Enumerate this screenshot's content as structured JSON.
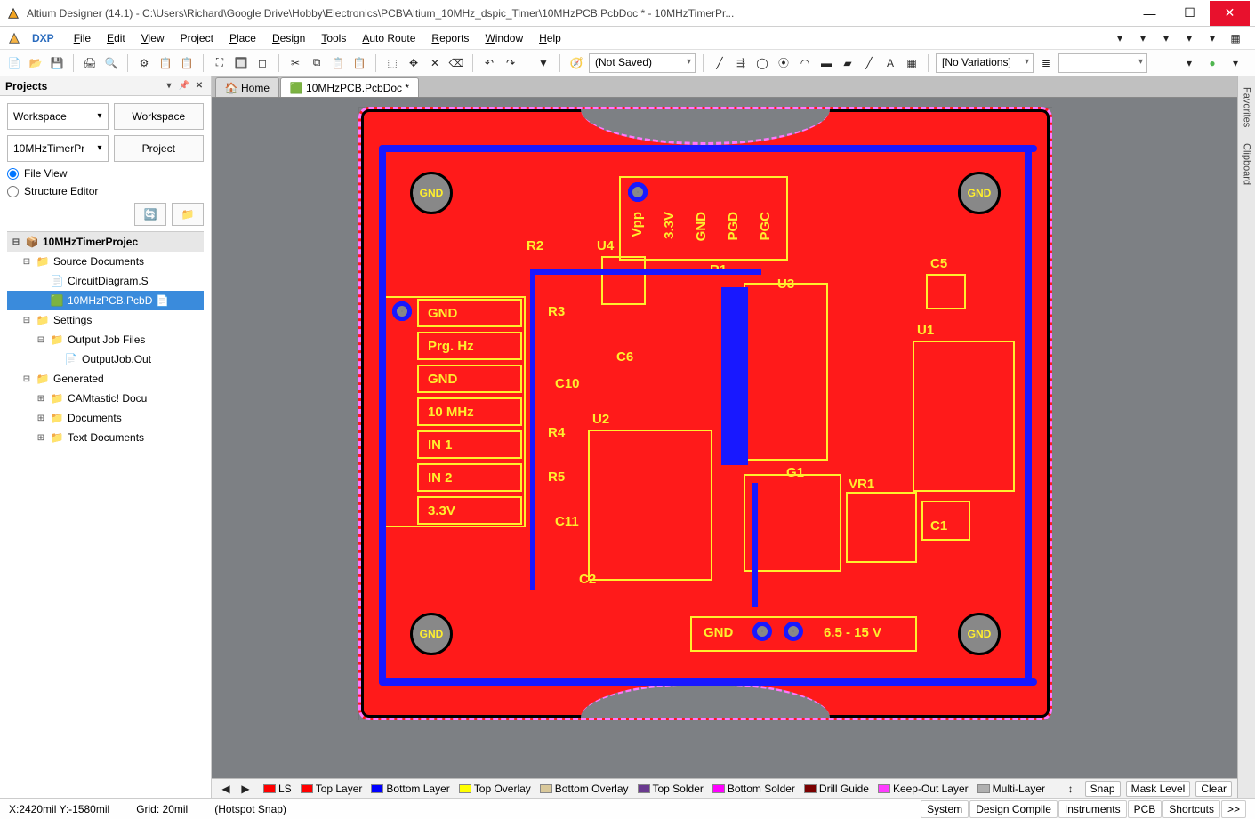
{
  "title": "Altium Designer (14.1) - C:\\Users\\Richard\\Google Drive\\Hobby\\Electronics\\PCB\\Altium_10MHz_dspic_Timer\\10MHzPCB.PcbDoc * - 10MHzTimerPr...",
  "menus": [
    "DXP",
    "File",
    "Edit",
    "View",
    "Project",
    "Place",
    "Design",
    "Tools",
    "Auto Route",
    "Reports",
    "Window",
    "Help"
  ],
  "toolbar_combo1": "(Not Saved)",
  "toolbar_combo2": "[No Variations]",
  "projects_panel_title": "Projects",
  "workspace_combo": "Workspace",
  "workspace_btn": "Workspace",
  "project_combo": "10MHzTimerPr",
  "project_btn": "Project",
  "radio_file_view": "File View",
  "radio_structure": "Structure Editor",
  "tree_root": "10MHzTimerProjec",
  "tree_src": "Source Documents",
  "tree_schematic": "CircuitDiagram.S",
  "tree_pcb": "10MHzPCB.PcbD",
  "tree_settings": "Settings",
  "tree_outjob_folder": "Output Job Files",
  "tree_outjob_file": "OutputJob.Out",
  "tree_generated": "Generated",
  "tree_cam": "CAMtastic! Docu",
  "tree_docs": "Documents",
  "tree_text": "Text Documents",
  "tab_home": "Home",
  "tab_pcb": "10MHzPCB.PcbDoc *",
  "rail_tabs": [
    "Favorites",
    "Clipboard"
  ],
  "layers": [
    {
      "name": "LS",
      "color": "#ff0000"
    },
    {
      "name": "Top Layer",
      "color": "#ff0000"
    },
    {
      "name": "Bottom Layer",
      "color": "#0000ff"
    },
    {
      "name": "Top Overlay",
      "color": "#ffff00"
    },
    {
      "name": "Bottom Overlay",
      "color": "#d9c89a"
    },
    {
      "name": "Top Solder",
      "color": "#6a3a8f"
    },
    {
      "name": "Bottom Solder",
      "color": "#ff00ff"
    },
    {
      "name": "Drill Guide",
      "color": "#7a0000"
    },
    {
      "name": "Keep-Out Layer",
      "color": "#ff3cff"
    },
    {
      "name": "Multi-Layer",
      "color": "#b0b0b0"
    }
  ],
  "layer_right": [
    "Snap",
    "Mask Level",
    "Clear"
  ],
  "status_coord": "X:2420mil Y:-1580mil",
  "status_grid": "Grid: 20mil",
  "status_snap": "(Hotspot Snap)",
  "status_right": [
    "System",
    "Design Compile",
    "Instruments",
    "PCB",
    "Shortcuts",
    ">>"
  ],
  "silk": {
    "gnd": "GND",
    "prg": "Prg. Hz",
    "mhz": "10 MHz",
    "in1": "IN 1",
    "in2": "IN 2",
    "v33": "3.3V",
    "vpp": "Vpp",
    "pgd": "PGD",
    "pgc": "PGC",
    "vin": "6.5 - 15 V",
    "u1": "U1",
    "u2": "U2",
    "u3": "U3",
    "u4": "U4",
    "g1": "G1",
    "vr1": "VR1",
    "r1": "R1",
    "r2": "R2",
    "r3": "R3",
    "r4": "R4",
    "r5": "R5",
    "c1": "C1",
    "c2": "C2",
    "c5": "C5",
    "c6": "C6",
    "c10": "C10",
    "c11": "C11"
  }
}
